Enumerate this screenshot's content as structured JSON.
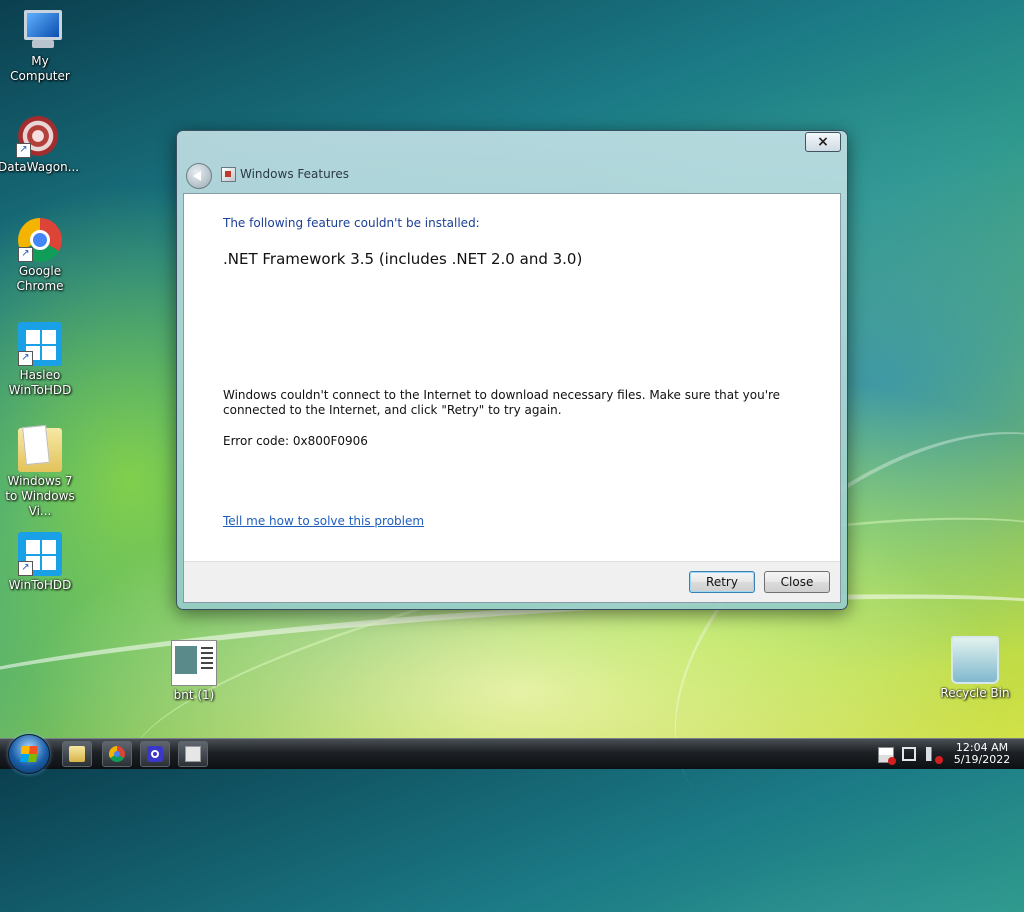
{
  "desktop": {
    "icons": [
      {
        "label": "My Computer",
        "icon": "computer-icon"
      },
      {
        "label": "DataWagon...",
        "icon": "datawagon-icon"
      },
      {
        "label": "Google Chrome",
        "icon": "chrome-icon"
      },
      {
        "label": "Hasleo WinToHDD",
        "icon": "windows-tile-icon"
      },
      {
        "label": "Windows 7 to Windows Vi...",
        "icon": "folder-icon"
      },
      {
        "label": "WinToHDD",
        "icon": "windows-tile-icon"
      },
      {
        "label": "bnt (1)",
        "icon": "document-icon"
      },
      {
        "label": "Recycle Bin",
        "icon": "recycle-bin-icon"
      }
    ]
  },
  "dialog": {
    "title": "Windows Features",
    "close_label": "×",
    "heading": "The following feature couldn't be installed:",
    "feature_name": ".NET Framework 3.5 (includes .NET 2.0 and 3.0)",
    "message": "Windows couldn't connect to the Internet to download necessary files. Make sure that you're connected to the Internet, and click \"Retry\" to try again.",
    "error_code": "Error code: 0x800F0906",
    "help_link": "Tell me how to solve this problem",
    "retry_label": "Retry",
    "close_button_label": "Close"
  },
  "taskbar": {
    "pinned": [
      "file-explorer-icon",
      "chrome-icon",
      "settings-gear-icon",
      "document-icon"
    ],
    "tray": [
      "action-center-flag-icon",
      "network-icon",
      "volume-muted-icon"
    ],
    "clock_time": "12:04 AM",
    "clock_date": "5/19/2022"
  },
  "colors": {
    "heading_blue": "#1b3f95",
    "link_blue": "#1f5fbf",
    "retry_focus": "#3c7fb1"
  }
}
